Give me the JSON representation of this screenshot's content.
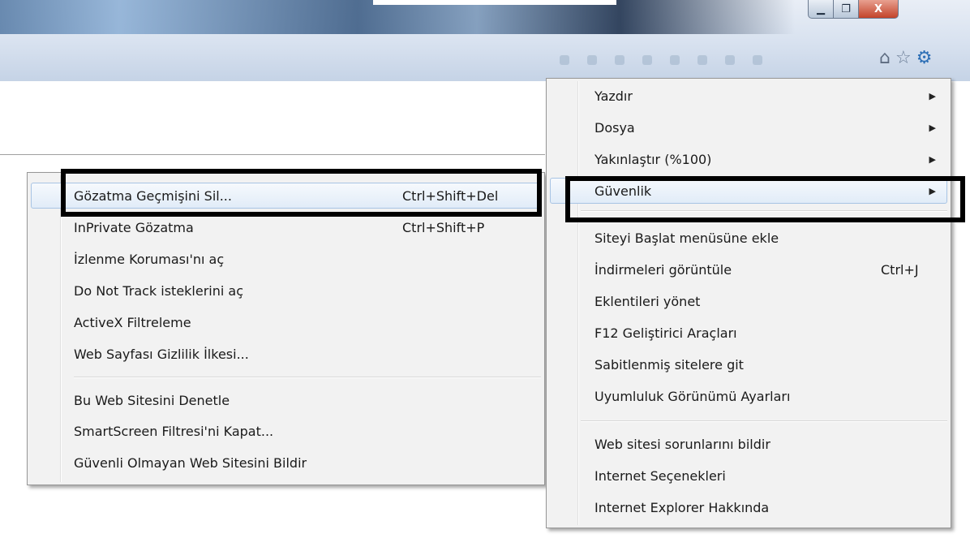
{
  "window": {
    "minimize_glyph": "▁",
    "maximize_glyph": "❐",
    "close_glyph": "X"
  },
  "toolbar_icons": [
    "home-icon",
    "favorites-star-icon",
    "gear-icon"
  ],
  "toolbar_glyphs": {
    "home": "⌂",
    "favorites": "☆",
    "tools": "⚙"
  },
  "submenu": {
    "items": [
      {
        "label": "Gözatma Geçmişini Sil...",
        "shortcut": "Ctrl+Shift+Del"
      },
      {
        "label": "InPrivate Gözatma",
        "shortcut": "Ctrl+Shift+P"
      },
      {
        "label": "İzlenme Koruması'nı aç",
        "shortcut": ""
      },
      {
        "label": "Do Not Track isteklerini aç",
        "shortcut": ""
      },
      {
        "label": "ActiveX Filtreleme",
        "shortcut": ""
      },
      {
        "label": "Web Sayfası Gizlilik İlkesi...",
        "shortcut": ""
      },
      {
        "label": "Bu Web Sitesini Denetle",
        "shortcut": ""
      },
      {
        "label": "SmartScreen Filtresi'ni Kapat...",
        "shortcut": ""
      },
      {
        "label": "Güvenli Olmayan Web Sitesini Bildir",
        "shortcut": ""
      }
    ]
  },
  "mainmenu": {
    "arrow_glyph": "▶",
    "items": [
      {
        "label": "Yazdır",
        "shortcut": ""
      },
      {
        "label": "Dosya",
        "shortcut": ""
      },
      {
        "label": "Yakınlaştır (%100)",
        "shortcut": ""
      },
      {
        "label": "Güvenlik",
        "shortcut": ""
      },
      {
        "label": "Siteyi Başlat menüsüne ekle",
        "shortcut": ""
      },
      {
        "label": "İndirmeleri görüntüle",
        "shortcut": "Ctrl+J"
      },
      {
        "label": "Eklentileri yönet",
        "shortcut": ""
      },
      {
        "label": "F12 Geliştirici Araçları",
        "shortcut": ""
      },
      {
        "label": "Sabitlenmiş sitelere git",
        "shortcut": ""
      },
      {
        "label": "Uyumluluk Görünümü Ayarları",
        "shortcut": ""
      },
      {
        "label": "Web sitesi sorunlarını bildir",
        "shortcut": ""
      },
      {
        "label": "Internet Seçenekleri",
        "shortcut": ""
      },
      {
        "label": "Internet Explorer Hakkında",
        "shortcut": ""
      }
    ]
  },
  "colors": {
    "highlight_border": "#a8c4e4",
    "menu_background": "#f2f2f2",
    "callout": "#000000",
    "close_button": "#c3432a"
  }
}
